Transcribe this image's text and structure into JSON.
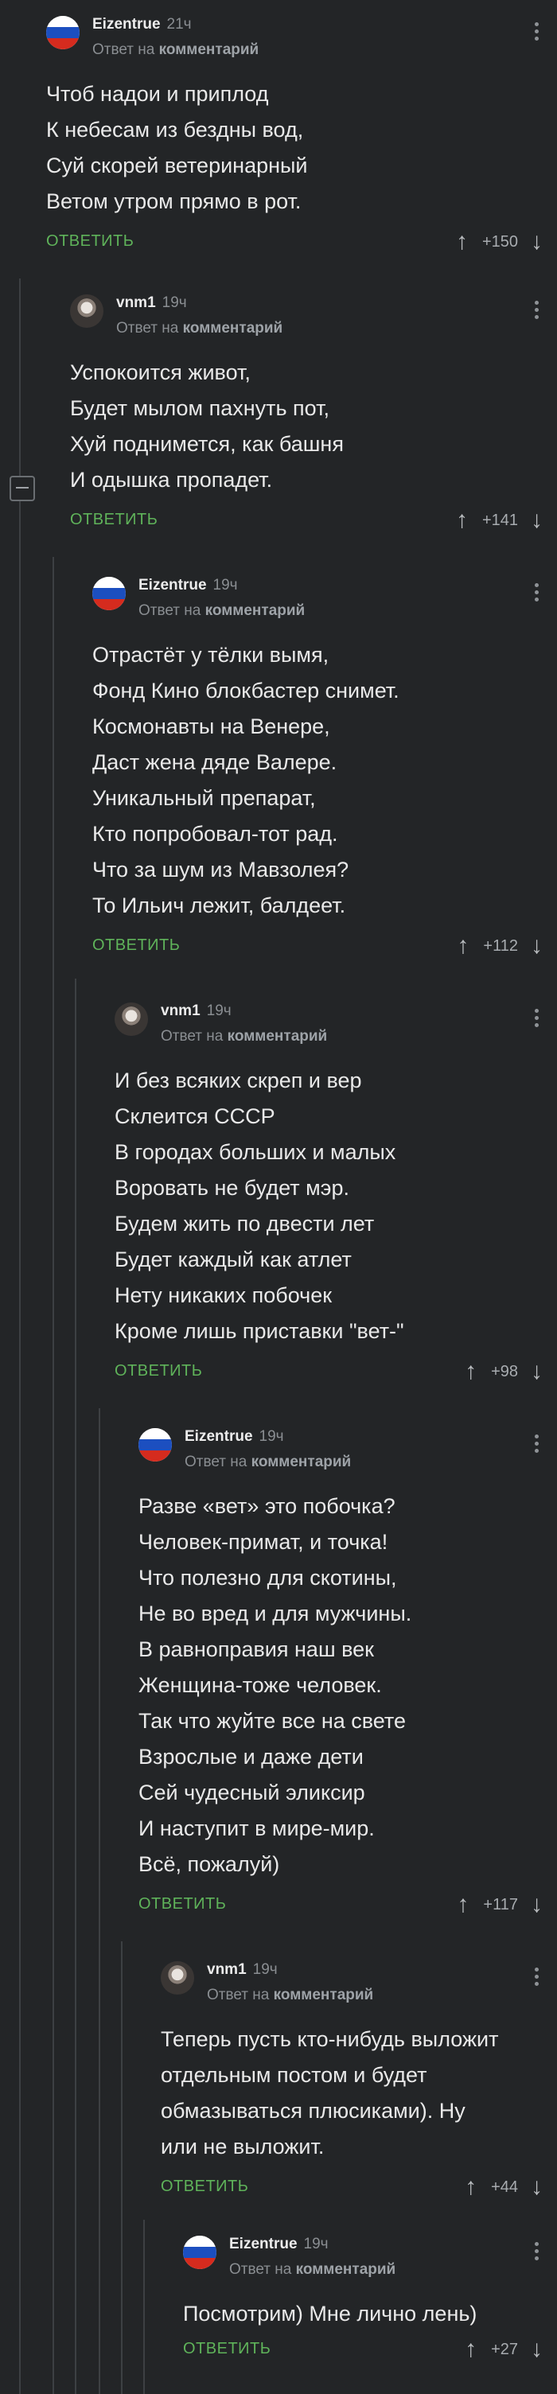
{
  "comments": [
    {
      "user": "Eizentrue",
      "time": "21ч",
      "avatar": "russia-flag",
      "reply_prefix": "Ответ на",
      "reply_target": "комментарий",
      "text": "Чтоб надои и приплод\nК небесам из бездны вод,\nСуй скорей ветеринарный\nВетом утром прямо в рот.",
      "reply_label": "ОТВЕТИТЬ",
      "rating": "+150"
    },
    {
      "user": "vnm1",
      "time": "19ч",
      "avatar": "user-photo",
      "reply_prefix": "Ответ на",
      "reply_target": "комментарий",
      "text": "Успокоится живот,\nБудет мылом пахнуть пот,\nХуй поднимется, как башня\nИ одышка пропадет.",
      "reply_label": "ОТВЕТИТЬ",
      "rating": "+141"
    },
    {
      "user": "Eizentrue",
      "time": "19ч",
      "avatar": "russia-flag",
      "reply_prefix": "Ответ на",
      "reply_target": "комментарий",
      "text": "Отрастёт у тёлки вымя,\nФонд Кино блокбастер снимет.\nКосмонавты на Венере,\nДаст жена дяде Валере.\nУникальный препарат,\nКто попробовал-тот рад.\nЧто за шум из Мавзолея?\nТо Ильич лежит, балдеет.",
      "reply_label": "ОТВЕТИТЬ",
      "rating": "+112"
    },
    {
      "user": "vnm1",
      "time": "19ч",
      "avatar": "user-photo",
      "reply_prefix": "Ответ на",
      "reply_target": "комментарий",
      "text": "И без всяких скреп и вер\nСклеится СССР\nВ городах больших и малых\nВоровать не будет мэр.\nБудем жить по двести лет\nБудет каждый как атлет\nНету никаких побочек\nКроме лишь приставки \"вет-\"",
      "reply_label": "ОТВЕТИТЬ",
      "rating": "+98"
    },
    {
      "user": "Eizentrue",
      "time": "19ч",
      "avatar": "russia-flag",
      "reply_prefix": "Ответ на",
      "reply_target": "комментарий",
      "text": "Разве «вет» это побочка?\nЧеловек-примат, и точка!\nЧто полезно для скотины,\nНе во вред и для мужчины.\nВ равноправия наш век\nЖенщина-тоже человек.\nТак что жуйте все на свете\nВзрослые и даже дети\nСей чудесный эликсир\nИ наступит в мире-мир.\nВсё, пожалуй)",
      "reply_label": "ОТВЕТИТЬ",
      "rating": "+117"
    },
    {
      "user": "vnm1",
      "time": "19ч",
      "avatar": "user-photo",
      "reply_prefix": "Ответ на",
      "reply_target": "комментарий",
      "text": "Теперь пусть кто-нибудь выложит\nотдельным постом и будет\nобмазываться плюсиками). Ну\nили не выложит.",
      "reply_label": "ОТВЕТИТЬ",
      "rating": "+44"
    },
    {
      "user": "Eizentrue",
      "time": "19ч",
      "avatar": "russia-flag",
      "reply_prefix": "Ответ на",
      "reply_target": "комментарий",
      "text": "Посмотрим) Мне лично лень)",
      "reply_label": "ОТВЕТИТЬ",
      "rating": "+27"
    }
  ],
  "icons": {
    "upvote": "arrow-up-icon",
    "downvote": "arrow-down-icon",
    "more": "more-vertical-icon",
    "collapse": "collapse-minus-icon"
  },
  "colors": {
    "background": "#232527",
    "reply_accent": "#5fb35a",
    "thread_line": "#3d4043"
  }
}
